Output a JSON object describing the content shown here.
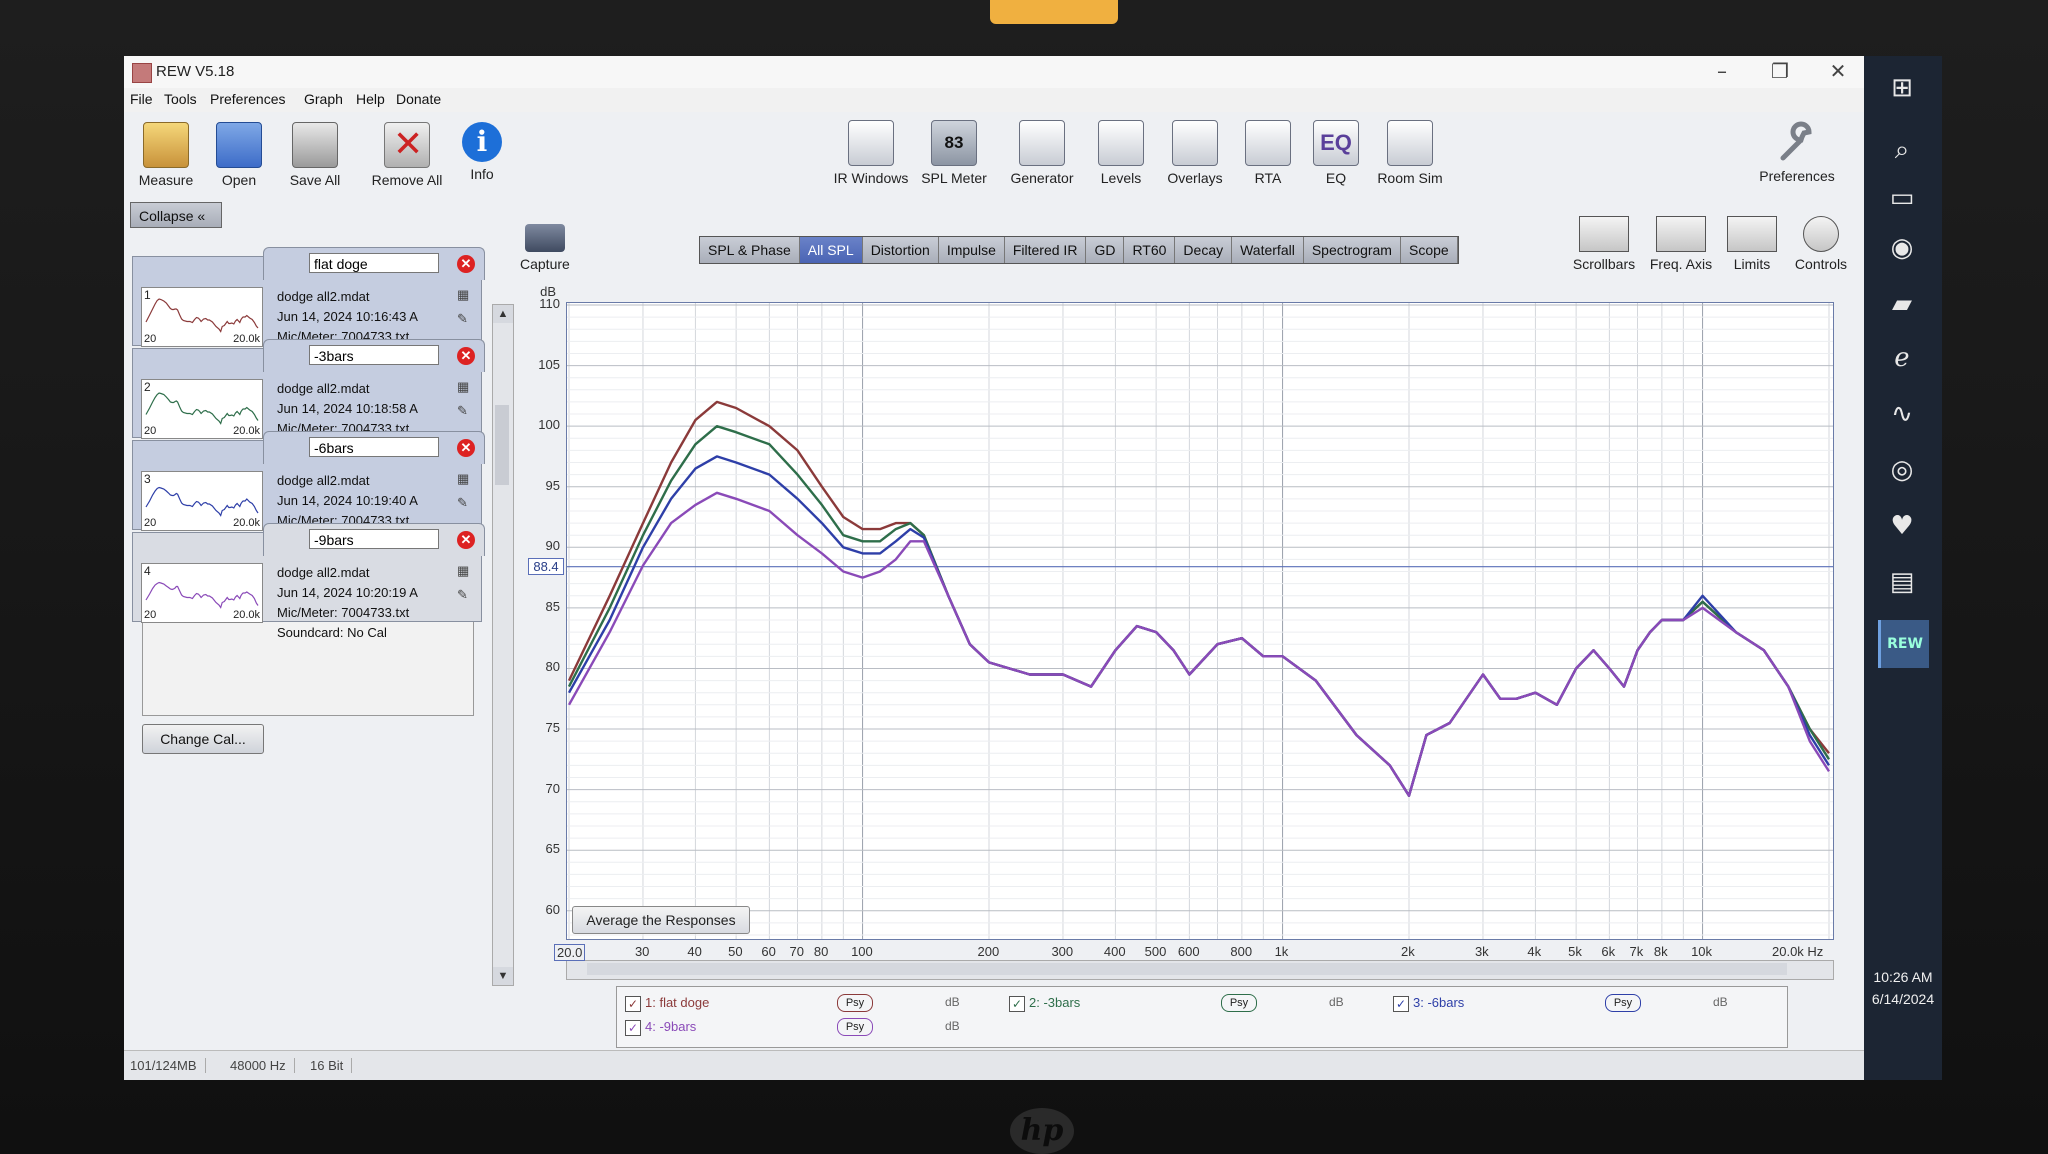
{
  "window": {
    "title": "REW V5.18"
  },
  "menu": [
    "File",
    "Tools",
    "Preferences",
    "Graph",
    "Help",
    "Donate"
  ],
  "toolbar_left": [
    {
      "label": "Measure",
      "icon": "measure-icon"
    },
    {
      "label": "Open",
      "icon": "folder-icon"
    },
    {
      "label": "Save All",
      "icon": "save-icon"
    },
    {
      "label": "Remove All",
      "icon": "remove-icon"
    },
    {
      "label": "Info",
      "icon": "info-icon"
    }
  ],
  "toolbar_center": [
    {
      "label": "IR Windows",
      "icon": "ir-windows-icon"
    },
    {
      "label": "SPL Meter",
      "icon": "spl-meter-icon",
      "glyph": "83"
    },
    {
      "label": "Generator",
      "icon": "generator-icon"
    },
    {
      "label": "Levels",
      "icon": "levels-icon"
    },
    {
      "label": "Overlays",
      "icon": "overlays-icon"
    },
    {
      "label": "RTA",
      "icon": "rta-icon"
    },
    {
      "label": "EQ",
      "icon": "eq-icon",
      "glyph": "EQ"
    },
    {
      "label": "Room Sim",
      "icon": "room-sim-icon"
    }
  ],
  "toolbar_right": {
    "label": "Preferences",
    "icon": "wrench-icon"
  },
  "collapse_label": "Collapse",
  "capture_label": "Capture",
  "graph_tabs": [
    "SPL & Phase",
    "All SPL",
    "Distortion",
    "Impulse",
    "Filtered IR",
    "GD",
    "RT60",
    "Decay",
    "Waterfall",
    "Spectrogram",
    "Scope"
  ],
  "active_tab": "All SPL",
  "right_tools": [
    "Scrollbars",
    "Freq. Axis",
    "Limits",
    "Controls"
  ],
  "measurements": [
    {
      "num": "1",
      "name": "flat doge",
      "file": "dodge all2.mdat",
      "date": "Jun 14, 2024 10:16:43 A",
      "mic": "Mic/Meter: 7004733.txt",
      "color": "#8b3a3a"
    },
    {
      "num": "2",
      "name": "-3bars",
      "file": "dodge all2.mdat",
      "date": "Jun 14, 2024 10:18:58 A",
      "mic": "Mic/Meter: 7004733.txt",
      "color": "#2e6e4a"
    },
    {
      "num": "3",
      "name": "-6bars",
      "file": "dodge all2.mdat",
      "date": "Jun 14, 2024 10:19:40 A",
      "mic": "Mic/Meter: 7004733.txt",
      "color": "#2e3fa8"
    },
    {
      "num": "4",
      "name": "-9bars",
      "file": "dodge all2.mdat",
      "date": "Jun 14, 2024 10:20:19 A",
      "mic": "Mic/Meter: 7004733.txt",
      "soundcard": "Soundcard: No Cal",
      "color": "#8a4ab8"
    }
  ],
  "thumb_range": {
    "low": "20",
    "high": "20.0k"
  },
  "change_cal_label": "Change Cal...",
  "average_label": "Average the Responses",
  "chart_data": {
    "type": "line",
    "ylabel": "dB",
    "ylim": [
      58,
      110
    ],
    "yticks": [
      "110",
      "105",
      "100",
      "95",
      "90",
      "85",
      "80",
      "75",
      "70",
      "65",
      "60"
    ],
    "xlim": [
      20,
      20000
    ],
    "xscale": "log",
    "xticks": [
      {
        "v": 20,
        "t": "20.0"
      },
      {
        "v": 30,
        "t": "30"
      },
      {
        "v": 40,
        "t": "40"
      },
      {
        "v": 50,
        "t": "50"
      },
      {
        "v": 60,
        "t": "60"
      },
      {
        "v": 70,
        "t": "70"
      },
      {
        "v": 80,
        "t": "80"
      },
      {
        "v": 100,
        "t": "100"
      },
      {
        "v": 200,
        "t": "200"
      },
      {
        "v": 300,
        "t": "300"
      },
      {
        "v": 400,
        "t": "400"
      },
      {
        "v": 500,
        "t": "500"
      },
      {
        "v": 600,
        "t": "600"
      },
      {
        "v": 800,
        "t": "800"
      },
      {
        "v": 1000,
        "t": "1k"
      },
      {
        "v": 2000,
        "t": "2k"
      },
      {
        "v": 3000,
        "t": "3k"
      },
      {
        "v": 4000,
        "t": "4k"
      },
      {
        "v": 5000,
        "t": "5k"
      },
      {
        "v": 6000,
        "t": "6k"
      },
      {
        "v": 7000,
        "t": "7k"
      },
      {
        "v": 8000,
        "t": "8k"
      },
      {
        "v": 10000,
        "t": "10k"
      },
      {
        "v": 20000,
        "t": "20.0k Hz"
      }
    ],
    "cursor": {
      "value": 88.4,
      "label": "88.4"
    },
    "x": [
      20,
      25,
      30,
      35,
      40,
      45,
      50,
      60,
      70,
      80,
      90,
      100,
      110,
      120,
      130,
      140,
      160,
      180,
      200,
      250,
      300,
      350,
      400,
      450,
      500,
      550,
      600,
      700,
      800,
      900,
      1000,
      1200,
      1500,
      1800,
      2000,
      2200,
      2500,
      3000,
      3300,
      3600,
      4000,
      4500,
      5000,
      5500,
      6000,
      6500,
      7000,
      7500,
      8000,
      9000,
      10000,
      12000,
      14000,
      16000,
      18000,
      20000
    ],
    "series": [
      {
        "name": "1: flat doge",
        "color": "#8b3a3a",
        "values": [
          79,
          86,
          92,
          97,
          100.5,
          102,
          101.5,
          100,
          98,
          95,
          92.5,
          91.5,
          91.5,
          92,
          92,
          91,
          86,
          82,
          80.5,
          79.5,
          79.5,
          78.5,
          81.5,
          83.5,
          83,
          81.5,
          79.5,
          82,
          82.5,
          81,
          81,
          79,
          74.5,
          72,
          69.5,
          74.5,
          75.5,
          79.5,
          77.5,
          77.5,
          78,
          77,
          80,
          81.5,
          80,
          78.5,
          81.5,
          83,
          84,
          84,
          85.5,
          83,
          81.5,
          78.5,
          75,
          73
        ]
      },
      {
        "name": "2: -3bars",
        "color": "#2e6e4a",
        "values": [
          78.5,
          85,
          91,
          95.5,
          98.5,
          100,
          99.5,
          98.5,
          96,
          93.5,
          91,
          90.5,
          90.5,
          91.5,
          92,
          91,
          86,
          82,
          80.5,
          79.5,
          79.5,
          78.5,
          81.5,
          83.5,
          83,
          81.5,
          79.5,
          82,
          82.5,
          81,
          81,
          79,
          74.5,
          72,
          69.5,
          74.5,
          75.5,
          79.5,
          77.5,
          77.5,
          78,
          77,
          80,
          81.5,
          80,
          78.5,
          81.5,
          83,
          84,
          84,
          85.5,
          83,
          81.5,
          78.5,
          75,
          72.5
        ]
      },
      {
        "name": "3: -6bars",
        "color": "#2e3fa8",
        "values": [
          78,
          84,
          90,
          94,
          96.5,
          97.5,
          97,
          96,
          94,
          92,
          90,
          89.5,
          89.5,
          90.5,
          91.5,
          90.8,
          86,
          82,
          80.5,
          79.5,
          79.5,
          78.5,
          81.5,
          83.5,
          83,
          81.5,
          79.5,
          82,
          82.5,
          81,
          81,
          79,
          74.5,
          72,
          69.5,
          74.5,
          75.5,
          79.5,
          77.5,
          77.5,
          78,
          77,
          80,
          81.5,
          80,
          78.5,
          81.5,
          83,
          84,
          84,
          86,
          83,
          81.5,
          78.5,
          74.5,
          72
        ]
      },
      {
        "name": "4: -9bars",
        "color": "#8a4ab8",
        "values": [
          77,
          83,
          88.5,
          92,
          93.5,
          94.5,
          94,
          93,
          91,
          89.5,
          88,
          87.5,
          88,
          89,
          90.5,
          90.5,
          86,
          82,
          80.5,
          79.5,
          79.5,
          78.5,
          81.5,
          83.5,
          83,
          81.5,
          79.5,
          82,
          82.5,
          81,
          81,
          79,
          74.5,
          72,
          69.5,
          74.5,
          75.5,
          79.5,
          77.5,
          77.5,
          78,
          77,
          80,
          81.5,
          80,
          78.5,
          81.5,
          83,
          84,
          84,
          85,
          83,
          81.5,
          78.5,
          74,
          71.5
        ]
      }
    ]
  },
  "legend": [
    {
      "label": "1: flat doge",
      "color": "#8b3a3a"
    },
    {
      "label": "2: -3bars",
      "color": "#2e6e4a"
    },
    {
      "label": "3: -6bars",
      "color": "#2e3fa8"
    },
    {
      "label": "4: -9bars",
      "color": "#8a4ab8"
    }
  ],
  "psy_label": "Psy",
  "db_new_label": "dB",
  "status": [
    "101/124MB",
    "48000 Hz",
    "16 Bit"
  ],
  "clock": {
    "time": "10:26 AM",
    "date": "6/14/2024"
  },
  "taskbar_icons": [
    "windows-start-icon",
    "search-icon",
    "task-view-icon",
    "edge-icon",
    "file-explorer-icon",
    "internet-explorer-icon",
    "activity-monitor-icon",
    "chrome-icon",
    "vivaldi-icon",
    "chart-app-icon",
    "rew-icon"
  ]
}
